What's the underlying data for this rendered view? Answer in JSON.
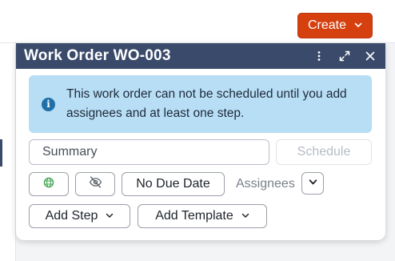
{
  "topbar": {
    "create_label": "Create"
  },
  "panel": {
    "title": "Work Order WO-003",
    "header_icons": [
      "more-vertical-icon",
      "expand-icon",
      "close-icon"
    ],
    "alert": {
      "icon": "info-icon",
      "text": "This work order can not be scheduled until you add assignees and at least one step."
    },
    "summary": {
      "value": "Summary",
      "placeholder": ""
    },
    "schedule_label": "Schedule",
    "due_date_label": "No Due Date",
    "assignees_label": "Assignees",
    "add_step_label": "Add Step",
    "add_template_label": "Add Template"
  },
  "colors": {
    "header_bg": "#3a4a6b",
    "create_bg": "#d6400f",
    "alert_bg": "#b8def5",
    "globe_green": "#3fa34d"
  }
}
